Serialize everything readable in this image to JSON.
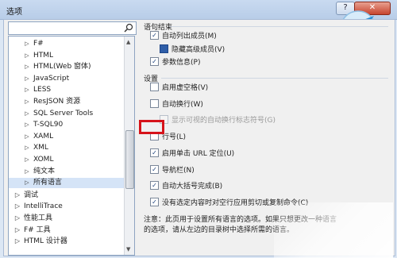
{
  "window": {
    "title": "选项",
    "help_label": "?",
    "close_label": "✕"
  },
  "search": {
    "placeholder": "",
    "value": ""
  },
  "tree": {
    "items": [
      {
        "label": "F#",
        "arrow": "▷",
        "level": 1
      },
      {
        "label": "HTML",
        "arrow": "▷",
        "level": 1
      },
      {
        "label": "HTML(Web 窗体)",
        "arrow": "▷",
        "level": 1
      },
      {
        "label": "JavaScript",
        "arrow": "▷",
        "level": 1
      },
      {
        "label": "LESS",
        "arrow": "▷",
        "level": 1
      },
      {
        "label": "ResJSON 资源",
        "arrow": "▷",
        "level": 1
      },
      {
        "label": "SQL Server Tools",
        "arrow": "▷",
        "level": 1
      },
      {
        "label": "T-SQL90",
        "arrow": "▷",
        "level": 1
      },
      {
        "label": "XAML",
        "arrow": "▷",
        "level": 1
      },
      {
        "label": "XML",
        "arrow": "▷",
        "level": 1
      },
      {
        "label": "XOML",
        "arrow": "▷",
        "level": 1
      },
      {
        "label": "纯文本",
        "arrow": "▷",
        "level": 1
      },
      {
        "label": "所有语言",
        "arrow": "▷",
        "level": 1,
        "selected": true
      },
      {
        "label": "调试",
        "arrow": "▷",
        "level": 0
      },
      {
        "label": "IntelliTrace",
        "arrow": "▷",
        "level": 0
      },
      {
        "label": "性能工具",
        "arrow": "▷",
        "level": 0
      },
      {
        "label": "F# 工具",
        "arrow": "▷",
        "level": 0
      },
      {
        "label": "HTML 设计器",
        "arrow": "▷",
        "level": 0
      }
    ]
  },
  "statement_completion": {
    "title": "语句结束",
    "options": [
      {
        "label": "自动列出成员(M)",
        "checked": true,
        "indent": 0
      },
      {
        "label": "隐藏高级成员(V)",
        "checked": true,
        "indent": 1
      },
      {
        "label": "参数信息(P)",
        "checked": true,
        "indent": 0
      }
    ]
  },
  "settings": {
    "title": "设置",
    "options": [
      {
        "label": "启用虚空格(V)",
        "checked": false,
        "indent": 0,
        "disabled": false
      },
      {
        "label": "自动换行(W)",
        "checked": false,
        "indent": 0,
        "disabled": false
      },
      {
        "label": "显示可视的自动换行标志符号(G)",
        "checked": false,
        "indent": 1,
        "disabled": true
      },
      {
        "label": "行号(L)",
        "checked": false,
        "indent": 0,
        "disabled": false
      },
      {
        "label": "启用单击 URL 定位(U)",
        "checked": true,
        "indent": 0,
        "disabled": false
      },
      {
        "label": "导航栏(N)",
        "checked": true,
        "indent": 0,
        "disabled": false
      },
      {
        "label": "自动大括号完成(B)",
        "checked": true,
        "indent": 0,
        "disabled": false
      },
      {
        "label": "没有选定内容时对空行应用剪切或复制命令(C)",
        "checked": true,
        "indent": 0,
        "disabled": false
      }
    ]
  },
  "note": "注意：此页用于设置所有语言的选项。如果只想更改一种语言的选项，请从左边的目录树中选择所需的语言。",
  "colors": {
    "highlight": "#d6131a",
    "accent": "#2f5ea8"
  }
}
